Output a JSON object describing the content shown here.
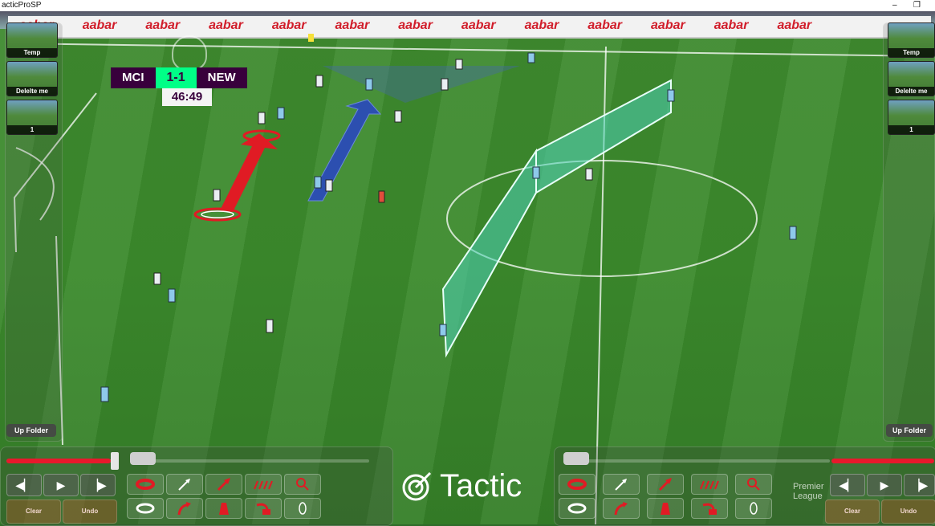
{
  "window": {
    "title": "acticProSP",
    "minimize": "–",
    "restore": "❐"
  },
  "adboard": {
    "words": [
      "aabar",
      "aabar",
      "aabar",
      "aabar",
      "aabar",
      "aabar",
      "aabar",
      "aabar",
      "aabar",
      "aabar",
      "aabar",
      "aabar",
      "aabar"
    ]
  },
  "scoreboard": {
    "home": "MCI",
    "score": "1-1",
    "away": "NEW",
    "clock": "46:49"
  },
  "left_thumbs": [
    {
      "label": "Temp"
    },
    {
      "label": "Delelte me"
    },
    {
      "label": "1"
    }
  ],
  "right_thumbs": [
    {
      "label": "Temp"
    },
    {
      "label": "Delelte me"
    },
    {
      "label": "1"
    }
  ],
  "folder": {
    "left": "Up Folder",
    "right": "Up Folder"
  },
  "controls": {
    "clear": "Clear",
    "undo": "Undo"
  },
  "brand": {
    "name": "Tactic",
    "league": "Premier\nLeague"
  },
  "colors": {
    "accent_red": "#e8192c",
    "wall_teal": "#4fd1b8",
    "arrow_blue": "#2c4fb0",
    "score_green": "#00ff87",
    "pl_purple": "#38003c"
  },
  "left_progress": 0.2,
  "right_progress": 0.75,
  "icons": [
    "prev-frame-icon",
    "play-icon",
    "next-frame-icon",
    "circle-marker-icon",
    "line-arrow-icon",
    "red-arrow-icon",
    "dotted-run-icon",
    "zoom-icon",
    "rotate-marker-icon",
    "curved-arrow-icon",
    "cone-icon",
    "pointer-arrow-icon",
    "ellipse-icon"
  ]
}
